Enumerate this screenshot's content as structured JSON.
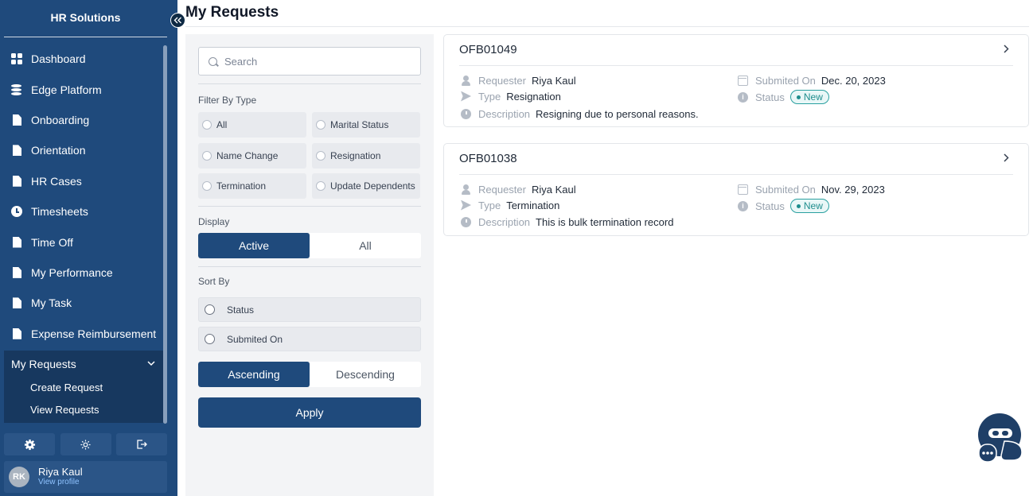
{
  "app": {
    "title": "HR Solutions"
  },
  "sidebar": {
    "items": [
      {
        "label": "Dashboard",
        "icon": "dashboard-icon"
      },
      {
        "label": "Edge Platform",
        "icon": "database-icon"
      },
      {
        "label": "Onboarding",
        "icon": "document-icon"
      },
      {
        "label": "Orientation",
        "icon": "document-icon"
      },
      {
        "label": "HR Cases",
        "icon": "document-icon"
      },
      {
        "label": "Timesheets",
        "icon": "clock-icon"
      },
      {
        "label": "Time Off",
        "icon": "document-icon"
      },
      {
        "label": "My Performance",
        "icon": "document-icon"
      },
      {
        "label": "My Task",
        "icon": "document-icon"
      },
      {
        "label": "Expense Reimbursement",
        "icon": "document-icon"
      }
    ],
    "group": {
      "label": "My Requests",
      "sub_items": [
        {
          "label": "Create Request"
        },
        {
          "label": "View Requests"
        }
      ]
    },
    "profile": {
      "initials": "RK",
      "name": "Riya Kaul",
      "link": "View profile"
    }
  },
  "page": {
    "title": "My Requests"
  },
  "filters": {
    "search_placeholder": "Search",
    "type_label": "Filter By Type",
    "types": [
      "All",
      "Marital Status",
      "Name Change",
      "Resignation",
      "Termination",
      "Update Dependents"
    ],
    "display_label": "Display",
    "display_options": [
      "Active",
      "All"
    ],
    "display_selected": "Active",
    "sort_label": "Sort By",
    "sort_options": [
      "Status",
      "Submited On"
    ],
    "order_options": [
      "Ascending",
      "Descending"
    ],
    "order_selected": "Ascending",
    "apply_label": "Apply"
  },
  "requests": [
    {
      "id": "OFB01049",
      "requester_label": "Requester",
      "requester": "Riya Kaul",
      "type_label": "Type",
      "type": "Resignation",
      "description_label": "Description",
      "description": "Resigning due to personal reasons.",
      "submitted_label": "Submited On",
      "submitted": "Dec. 20, 2023",
      "status_label": "Status",
      "status": "New"
    },
    {
      "id": "OFB01038",
      "requester_label": "Requester",
      "requester": "Riya Kaul",
      "type_label": "Type",
      "type": "Termination",
      "description_label": "Description",
      "description": "This is bulk termination record",
      "submitted_label": "Submited On",
      "submitted": "Nov. 29, 2023",
      "status_label": "Status",
      "status": "New"
    }
  ],
  "colors": {
    "sidebar": "#1f4a7c",
    "accent": "#1f4a7c",
    "status_new": "#1f8d8d"
  }
}
